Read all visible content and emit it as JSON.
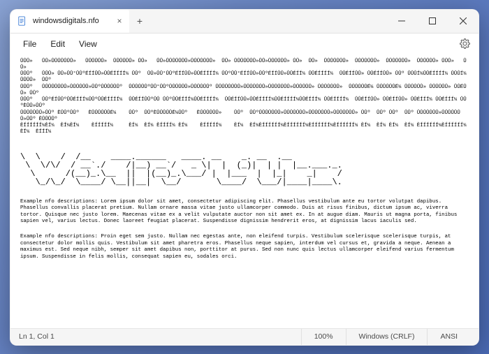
{
  "titlebar": {
    "tab_title": "windowsdigitals.nfo",
    "tab_close": "×",
    "new_tab": "+"
  },
  "menu": {
    "file": "File",
    "edit": "Edit",
    "view": "View"
  },
  "content": {
    "glyph_block": "ÛÛÛ»   ÛÛ»ÛÛÛÛÛÛÛ»   ÛÛÛÛÛÛ»  ÛÛÛÛÛÛ» ÛÛ»   ÛÛ»ÛÛÛÛÛÛÛ»ÛÛÛÛÛÛÛ»  ÛÛ» ÛÛÛÛÛÛÛ»ÛÛ»ÛÛÛÛÛÛ» ÛÛ»  ÛÛ»  ÛÛÛÛÛÛÛ»  ÛÛÛÛÛÛÛ»  ÛÛÛÛÛÛÛ»  ÛÛÛÛÛÛ» ÛÛÛ»   ÛÛ»\nÛÛÛº   ÛÛÛ» ÛÛ»ÛÛ°ÛÛºÉÍÍÛÛ»ÛÛÉÍÍÍÍ¼ ÛÛº  ÛÛ»ÛÛ°ÛÛºÉÍÍÛÛ»ÛÛÉÍÍÍÍ¼ ÛÛºÛÛ°ÉÍÍÛÛ»ÛÛºÉÍÍÛÛ»ÛÛÉÍÍ¼ ÛÛÉÍÍÍÍ¼  ÛÛÉÍÍÛÛ» ÛÛÉÍÍÛÛ» ÛÛº ÛÛÛÍ¼ÛÛÉÍÍÍÍ¼ ÛÛÛÍ¼  ÛÛÛÛ»  ÛÛº\nÛÛÛº   ÛÛÛÛÛÛÛÛ»ÛÛÛÛÛÛ»ÛÛºÛÛÛÛÛÛº  ÛÛÛÛÛÛºÛÛ°ÛÛºÛÛÛÛÛÛ»ÛÛÛÛÛÛº ÛÛÛÛÛÛÛÛ»ÛÛÛÛÛÛÛ»ÛÛÛÛÛÛÛ»ÛÛÛÛÛÛ» ÛÛÛÛÛÛÛ»  ÛÛÛÛÛÛÉ¼ ÛÛÛÛÛÛÉ¼ ÛÛÛÛÛÛ» ÛÛÛÛÛÛ» ÛÛÉÛÛ» ÛÛº\nÛÛÛº   ÛÛºÉÍÛÛºÛÛÉÍÍÍ¼ÛÛºÛÛÉÍÍÍÍ¼  ÛÛÉÍÍÛÛºÛÛ ÛÛºÛÛÉÍÍÍ¼ÛÛÉÍÍÍÍ¼  ÛÛÉÍÍÛÛ»ÛÛÉÍÍÍÍ¼ÛÛÉÍÍÍÍ¼ÛÛÉÍÍÍ¼ ÛÛÉÍÍÍÍ¼  ÛÛÉÍÍÛÛ» ÛÛÉÍÍÛÛ» ÛÛÉÍÍÍ¼ ÛÛÉÍÍÍ¼ ÛÛºÈÛÛ»ÛÛº\nÛÛÛÛÛÛÛ»ÛÛº ÈÛÛºÛÛº   ÈÛÛÛÛÛÛÉ¼    ÛÛº  ÛÛºÈÛÛÛÛÛÉ¼ÛÛº   ÈÛÛÛÛÛÛ»    ÛÛº  ÛÛºÛÛÛÛÛÛÛ»ÛÛÛÛÛÛÛ»ÛÛÛÛÛÛÛ»ÛÛÛÛÛÛÛ» ÛÛº  ÛÛº ÛÛº  ÛÛº ÛÛÛÛÛÛÛ»ÛÛÛÛÛÛÛ»ÛÛº ÈÛÛÛÛº\nÈÍÍÍÍÍÍ¼ÈÍ¼  ÈÍ¼ÈÍ¼    ÈÍÍÍÍÍ¼     ÈÍ¼  ÈÍ¼ ÈÍÍÍÍ¼ ÈÍ¼    ÈÍÍÍÍÍ¼    ÈÍ¼  ÈÍ¼ÈÍÍÍÍÍÍ¼ÈÍÍÍÍÍÍ¼ÈÍÍÍÍÍÍ¼ÈÍÍÍÍÍÍ¼ ÈÍ¼  ÈÍ¼ ÈÍ¼  ÈÍ¼ ÈÍÍÍÍÍÍ¼ÈÍÍÍÍÍÍ¼ÈÍ¼  ÈÍÍÍ¼",
    "ascii_art": "\\  \\    /  /__    ____.______   ____. __    _. __  .__\n \\  \\/\\/  / __`./    /|__) __`/   _ \\|  |  (_)|  | |  |__.___._.\n  \\      /(__)_.\\__  ||  |(__)_.\\___/ |  |___  |  |_|    _|    /\n   \\_/\\_/  \\____/ \\__||__|  \\__/       \\____/  \\___/|____|____\\.",
    "para1": "Example nfo descriptions: Lorem ipsum dolor sit amet, consectetur adipiscing elit. Phasellus vestibulum ante eu tortor volutpat dapibus. Phasellus convallis placerat pretium. Nullam ornare massa vitae justo ullamcorper commodo. Duis at risus finibus, dictum ipsum ac, viverra tortor. Quisque nec justo lorem. Maecenas vitae ex a velit vulputate auctor non sit amet ex. In at augue diam. Mauris ut magna porta, finibus sapien vel, varius lectus. Donec laoreet feugiat placerat. Suspendisse dignissim hendrerit eros, at dignissim lacus iaculis sed.",
    "para2": "Example nfo descriptions: Proin eget sem justo. Nullam nec egestas ante, non eleifend turpis. Vestibulum scelerisque scelerisque turpis, at consectetur dolor mollis quis. Vestibulum sit amet pharetra eros. Phasellus neque sapien, interdum vel cursus et, gravida a neque. Aenean a maximus est. Sed neque nibh, semper sit amet dapibus non, porttitor at purus. Sed non nunc quis lectus ullamcorper eleifend varius fermentum ipsum. Suspendisse in felis mollis, consequat sapien eu, sodales orci."
  },
  "status": {
    "position": "Ln 1, Col 1",
    "zoom": "100%",
    "line_ending": "Windows (CRLF)",
    "encoding": "ANSI"
  }
}
